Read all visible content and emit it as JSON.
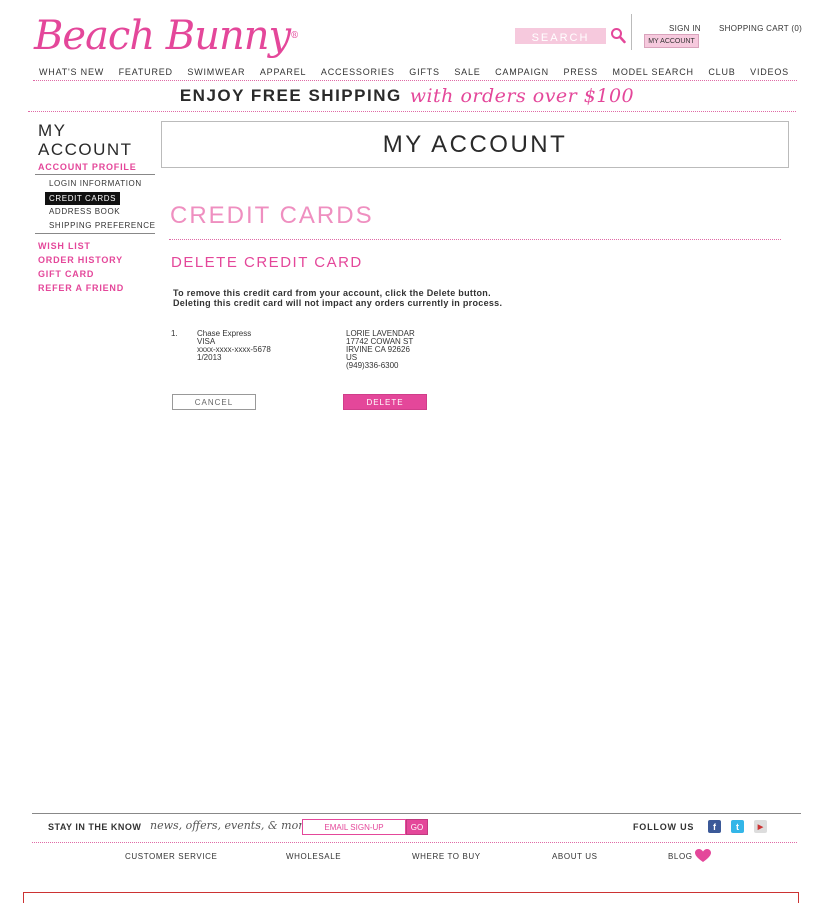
{
  "header": {
    "logo_text": "Beach Bunny",
    "logo_tm": "®",
    "search_placeholder": "SEARCH",
    "sign_in": "SIGN IN",
    "shopping_cart": "SHOPPING CART (0)",
    "my_account": "MY ACCOUNT"
  },
  "nav": [
    "WHAT'S NEW",
    "FEATURED",
    "SWIMWEAR",
    "APPAREL",
    "ACCESSORIES",
    "GIFTS",
    "SALE",
    "CAMPAIGN",
    "PRESS",
    "MODEL SEARCH",
    "CLUB",
    "VIDEOS"
  ],
  "promo": {
    "bold": "ENJOY FREE SHIPPING",
    "script": "with orders over $100"
  },
  "sidebar": {
    "title_line1": "MY",
    "title_line2": "ACCOUNT",
    "account_profile": "ACCOUNT PROFILE",
    "sub_items": [
      "LOGIN INFORMATION",
      "CREDIT CARDS",
      "ADDRESS BOOK",
      "SHIPPING PREFERENCE"
    ],
    "links": [
      "WISH LIST",
      "ORDER HISTORY",
      "GIFT CARD",
      "REFER A FRIEND"
    ]
  },
  "main": {
    "page_title": "MY ACCOUNT",
    "section_heading": "CREDIT CARDS",
    "sub_heading": "DELETE CREDIT CARD",
    "instruction1": "To remove this credit card from your account, click the Delete button.",
    "instruction2": "Deleting this credit card will not impact any orders currently in process.",
    "card": {
      "index": "1.",
      "bank": "Chase Express",
      "type": "VISA",
      "number": "xxxx-xxxx-xxxx-5678",
      "expiry": "1/2013"
    },
    "address": {
      "name": "LORIE LAVENDAR",
      "street": "17742 COWAN ST",
      "city_state_zip": "IRVINE CA 92626",
      "country": "US",
      "phone": "(949)336-6300"
    },
    "cancel_label": "CANCEL",
    "delete_label": "DELETE"
  },
  "footer": {
    "stay": "STAY IN THE KNOW",
    "stay_script": "news, offers, events, & more",
    "email_placeholder": "EMAIL SIGN-UP",
    "go": "GO",
    "follow": "FOLLOW US",
    "links": [
      "CUSTOMER SERVICE",
      "WHOLESALE",
      "WHERE TO BUY",
      "ABOUT US",
      "BLOG"
    ]
  },
  "colors": {
    "brand_pink": "#e4479a",
    "light_pink": "#f6c9dd"
  },
  "icons": [
    "search-icon",
    "facebook-icon",
    "twitter-icon",
    "youtube-icon",
    "heart-icon"
  ]
}
